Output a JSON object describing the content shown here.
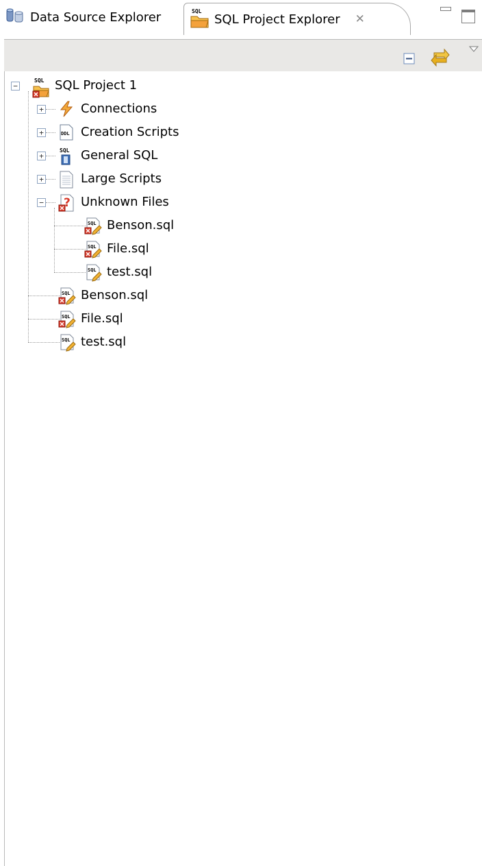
{
  "tabs": [
    {
      "label": "Data Source Explorer",
      "icon": "database-icon",
      "active": false
    },
    {
      "label": "SQL Project Explorer",
      "icon": "sql-project-folder-icon",
      "active": true
    }
  ],
  "tab_close_glyph": "✕",
  "window_buttons": [
    "minimize-icon",
    "maximize-icon"
  ],
  "toolbar": {
    "buttons": [
      "collapse-all-icon",
      "link-with-editor-icon",
      "view-menu-icon"
    ]
  },
  "tree": {
    "root": {
      "label": "SQL Project 1",
      "expanded": true,
      "icon": "sql-project-icon"
    },
    "children": [
      {
        "label": "Connections",
        "expanded": false,
        "icon": "connections-icon"
      },
      {
        "label": "Creation Scripts",
        "expanded": false,
        "icon": "ddl-script-icon"
      },
      {
        "label": "General SQL",
        "expanded": false,
        "icon": "general-sql-icon"
      },
      {
        "label": "Large Scripts",
        "expanded": false,
        "icon": "large-scripts-icon"
      },
      {
        "label": "Unknown Files",
        "expanded": true,
        "icon": "unknown-files-icon",
        "children": [
          {
            "label": "Benson.sql",
            "icon": "sql-file-error-icon"
          },
          {
            "label": "File.sql",
            "icon": "sql-file-error-icon"
          },
          {
            "label": "test.sql",
            "icon": "sql-file-icon"
          }
        ]
      },
      {
        "label": "Benson.sql",
        "icon": "sql-file-error-icon"
      },
      {
        "label": "File.sql",
        "icon": "sql-file-error-icon"
      },
      {
        "label": "test.sql",
        "icon": "sql-file-icon"
      }
    ]
  },
  "icon_badges": {
    "sql": "SQL",
    "ddl": "DDL",
    "unknown": "?"
  },
  "colors": {
    "toolbar_bg": "#e9e8e6",
    "folder_orange": "#f4a23c",
    "error_red": "#d83a2a",
    "link_gold": "#e8b020"
  }
}
